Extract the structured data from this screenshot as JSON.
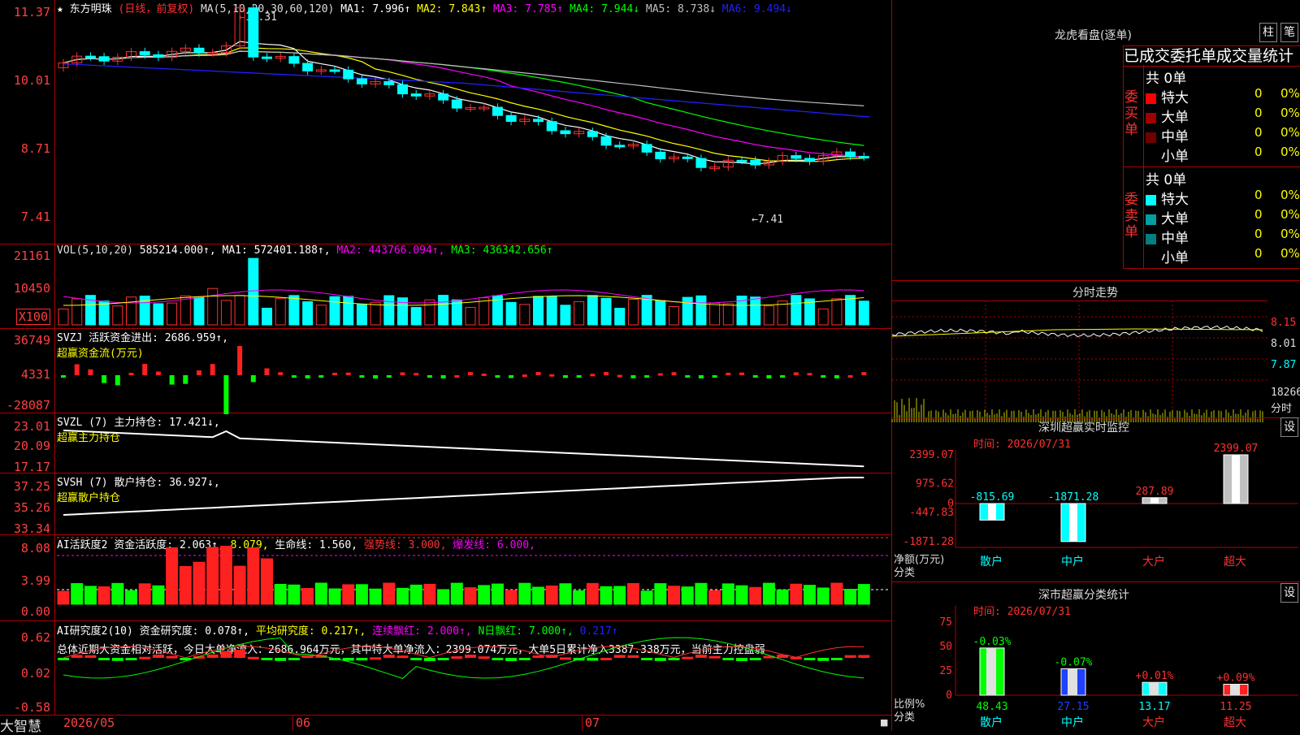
{
  "stock": {
    "star": "★",
    "name": "东方明珠",
    "period": "(日线，前复权)"
  },
  "main": {
    "ma_label": "MA(5,10,20,30,60,120)",
    "ma": [
      {
        "t": "MA1: 7.996↑",
        "c": "#ffffff"
      },
      {
        "t": "MA2: 7.843↑",
        "c": "#ffff00"
      },
      {
        "t": "MA3: 7.785↑",
        "c": "#ff00ff"
      },
      {
        "t": "MA4: 7.944↓",
        "c": "#00ff00"
      },
      {
        "t": "MA5: 8.738↓",
        "c": "#c0c0c0"
      },
      {
        "t": "MA6: 9.494↓",
        "c": "#2020ff"
      }
    ],
    "y_ticks": [
      "11.37",
      "10.01",
      "8.71",
      "7.41"
    ],
    "hi_note": "11.31",
    "lo_note": "7.41"
  },
  "vol": {
    "label": "VOL(5,10,20)",
    "value": "585214.000↑,",
    "ma": [
      {
        "t": "MA1: 572401.188↑,",
        "c": "#ffffff"
      },
      {
        "t": "MA2: 443766.094↑,",
        "c": "#ff00ff"
      },
      {
        "t": "MA3: 436342.656↑",
        "c": "#00ff00"
      }
    ],
    "y_ticks": [
      "21161",
      "10450"
    ],
    "unit": "X100"
  },
  "svzj": {
    "label": "SVZJ  活跃资金进出: 2686.959↑,",
    "sub": "超赢资金流(万元)",
    "y_ticks": [
      "36749",
      "4331",
      "-28087"
    ]
  },
  "svzl": {
    "label": "SVZL (7) 主力持仓: 17.421↓,",
    "sub": "超赢主力持仓",
    "y_ticks": [
      "23.01",
      "20.09",
      "17.17"
    ]
  },
  "svsh": {
    "label": "SVSH (7) 散户持仓: 36.927↓,",
    "sub": "超赢散户持仓",
    "y_ticks": [
      "37.25",
      "35.26",
      "33.34"
    ]
  },
  "ai1": {
    "label": "AI活跃度2 资金活跃度: 2.063↑,",
    "v2": "8.079,",
    "life": "生命线: 1.560,",
    "strong": "强势线: 3.000,",
    "burst": "爆发线: 6.000,",
    "y_ticks": [
      "8.08",
      "3.99",
      "0.00"
    ]
  },
  "ai2": {
    "label": "AI研究度2(10) 资金研究度: 0.078↑,",
    "avg": "平均研究度: 0.217↑,",
    "red": "连续飘红: 2.000↑,",
    "nred": "N日飘红: 7.000↑,",
    "last": "0.217↑",
    "summary": "总体近期大资金相对活跃，今日大单净流入：2686.964万元，其中特大单净流入：2399.074万元，大单5日累计净入3387.338万元，当前主力控盘弱",
    "y_ticks": [
      "0.62",
      "0.02",
      "-0.58"
    ]
  },
  "xaxis": {
    "brand": "大智慧",
    "months": [
      "2026/05",
      "06",
      "07"
    ]
  },
  "longhu": {
    "title": "龙虎看盘(逐单)",
    "btn1": "柱",
    "btn2": "笔",
    "subtitle": "已成交委托单成交量统计",
    "buy_side": "委买单",
    "sell_side": "委卖单",
    "buy_total": "共 0单",
    "sell_total": "共 0单",
    "buy_rows": [
      {
        "label": "特大",
        "n": "0",
        "p": "0%",
        "c": "#ff0000"
      },
      {
        "label": "大单",
        "n": "0",
        "p": "0%",
        "c": "#a00000"
      },
      {
        "label": "中单",
        "n": "0",
        "p": "0%",
        "c": "#700000"
      },
      {
        "label": "小单",
        "n": "0",
        "p": "0%",
        "c": ""
      }
    ],
    "sell_rows": [
      {
        "label": "特大",
        "n": "0",
        "p": "0%",
        "c": "#00ffff"
      },
      {
        "label": "大单",
        "n": "0",
        "p": "0%",
        "c": "#00a0a0"
      },
      {
        "label": "中单",
        "n": "0",
        "p": "0%",
        "c": "#008080"
      },
      {
        "label": "小单",
        "n": "0",
        "p": "0%",
        "c": ""
      }
    ]
  },
  "intraday": {
    "title": "分时走势",
    "y_ticks": [
      "8.15",
      "8.01",
      "7.87"
    ],
    "vol_max": "18266",
    "vol_unit": "分时"
  },
  "monitor": {
    "title": "深圳超赢实时监控",
    "btn": "设",
    "time": "时间: 2026/07/31",
    "y_ticks": [
      "2399.07",
      "975.62",
      "0",
      "-447.83",
      "-1871.28"
    ],
    "ylabel": "净额(万元)",
    "xlabel": "分类",
    "bars": [
      {
        "cat": "散户",
        "v": -815.69,
        "label": "-815.69"
      },
      {
        "cat": "中户",
        "v": -1871.28,
        "label": "-1871.28"
      },
      {
        "cat": "大户",
        "v": 287.89,
        "label": "287.89"
      },
      {
        "cat": "超大",
        "v": 2399.07,
        "label": "2399.07"
      }
    ]
  },
  "stat": {
    "title": "深市超赢分类统计",
    "btn": "设",
    "time": "时间: 2026/07/31",
    "y_ticks": [
      "75",
      "50",
      "25",
      "0"
    ],
    "ylabel": "比例%",
    "xlabel": "分类",
    "bars": [
      {
        "cat": "散户",
        "v": 48.43,
        "label": "48.43",
        "delta": "-0.03%"
      },
      {
        "cat": "中户",
        "v": 27.15,
        "label": "27.15",
        "delta": "-0.07%"
      },
      {
        "cat": "大户",
        "v": 13.17,
        "label": "13.17",
        "delta": "+0.01%"
      },
      {
        "cat": "超大",
        "v": 11.25,
        "label": "11.25",
        "delta": "+0.09%"
      }
    ]
  }
}
